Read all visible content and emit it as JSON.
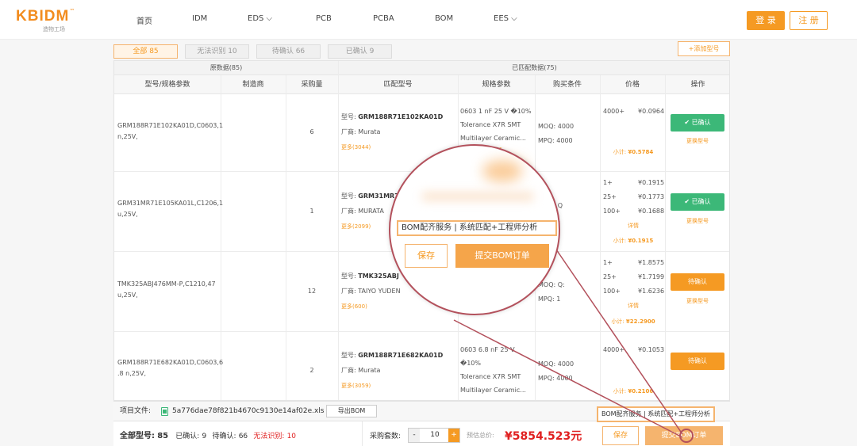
{
  "header": {
    "logo": "KBIDM",
    "logo_tm": "™",
    "logo_sub": "造物工场",
    "nav": [
      {
        "label": "首页"
      },
      {
        "label": "IDM"
      },
      {
        "label": "EDS ⌵"
      },
      {
        "label": "PCB"
      },
      {
        "label": "PCBA"
      },
      {
        "label": "BOM"
      },
      {
        "label": "EES ⌵"
      }
    ],
    "login": "登 录",
    "register": "注 册"
  },
  "tabs": [
    {
      "label": "全部 85"
    },
    {
      "label": "无法识别 10"
    },
    {
      "label": "待确认 66"
    },
    {
      "label": "已确认 9"
    }
  ],
  "add_model": "+添加型号",
  "table": {
    "group_raw": "原数据(85)",
    "group_matched": "已匹配数据(75)",
    "columns": [
      "型号/规格参数",
      "制造商",
      "采购量",
      "匹配型号",
      "规格参数",
      "购买条件",
      "价格",
      "操作"
    ],
    "labels": {
      "model": "型号:",
      "maker": "厂商:",
      "moq": "MOQ:",
      "mpq": "MPQ:",
      "subtotal": "小计:",
      "detail": "详情",
      "change": "更换型号"
    },
    "rows": [
      {
        "spec_lines": [
          "GRM188R71E102KA01D,C0603,1",
          "n,25V,"
        ],
        "qty": "6",
        "model": "GRM188R71E102KA01D",
        "maker": "Murata",
        "more": "更多(3044)",
        "spec": [
          "0603 1 nF 25 V �10%",
          "Tolerance X7R SMT",
          "Multilayer Ceramic..."
        ],
        "moq": "4000",
        "mpq": "4000",
        "prices": [
          {
            "qty": "4000+",
            "price": "¥0.0964"
          }
        ],
        "subtotal": "¥0.5784",
        "action": "✔ 已确认",
        "status": "confirmed"
      },
      {
        "spec_lines": [
          "GRM31MR71E105KA01L,C1206,1",
          "u,25V,"
        ],
        "qty": "1",
        "model": "GRM31MR71E",
        "maker": "MURATA",
        "more": "更多(2099)",
        "spec": [],
        "moq": "Q",
        "mpq": "1",
        "prices": [
          {
            "qty": "1+",
            "price": "¥0.1915"
          },
          {
            "qty": "25+",
            "price": "¥0.1773"
          },
          {
            "qty": "100+",
            "price": "¥0.1688"
          }
        ],
        "subtotal": "¥0.1915",
        "action": "✔ 已确认",
        "status": "confirmed"
      },
      {
        "spec_lines": [
          "TMK325ABJ476MM-P,C1210,47",
          "u,25V,"
        ],
        "qty": "12",
        "model": "TMK325ABJ",
        "maker": "TAIYO YUDEN",
        "more": "更多(600)",
        "spec": [],
        "moq": "Q:",
        "mpq": "1",
        "prices": [
          {
            "qty": "1+",
            "price": "¥1.8575"
          },
          {
            "qty": "25+",
            "price": "¥1.7199"
          },
          {
            "qty": "100+",
            "price": "¥1.6236"
          }
        ],
        "subtotal": "¥22.2900",
        "action": "待确认",
        "status": "pending"
      },
      {
        "spec_lines": [
          "GRM188R71E682KA01D,C0603,6",
          ".8 n,25V,"
        ],
        "qty": "2",
        "model": "GRM188R71E682KA01D",
        "maker": "Murata",
        "more": "更多(3059)",
        "spec": [
          "0603 6.8 nF 25 V �10%",
          "Tolerance X7R SMT",
          "Multilayer Ceramic..."
        ],
        "moq": "4000",
        "mpq": "4000",
        "prices": [
          {
            "qty": "4000+",
            "price": "¥0.1053"
          }
        ],
        "subtotal": "¥0.2106",
        "action": "待确认",
        "status": "pending"
      }
    ]
  },
  "footer": {
    "file_label": "项目文件:",
    "file_name": "5a776dae78f821b4670c9130e14af02e.xls",
    "export": "导出BOM",
    "total_label": "全部型号:",
    "total": "85",
    "confirmed_label": "已确认:",
    "confirmed": "9",
    "pending_label": "待确认:",
    "pending": "66",
    "unrec_label": "无法识别:",
    "unrec": "10",
    "sets_label": "采购套数:",
    "sets": "10",
    "minus": "-",
    "plus": "+",
    "est_label": "预估总价:",
    "est_total": "¥5854.523元",
    "save": "保存",
    "submit": "提交BOM订单"
  },
  "callout": "BOM配齐服务 | 系统匹配+工程师分析",
  "magnifier": {
    "callout": "BOM配齐服务 | 系统匹配+工程师分析",
    "save": "保存",
    "submit": "提交BOM订单"
  },
  "colors": {
    "accent": "#f59a23",
    "confirm": "#3cb878",
    "red": "#e02020",
    "ring": "#b3515c"
  }
}
